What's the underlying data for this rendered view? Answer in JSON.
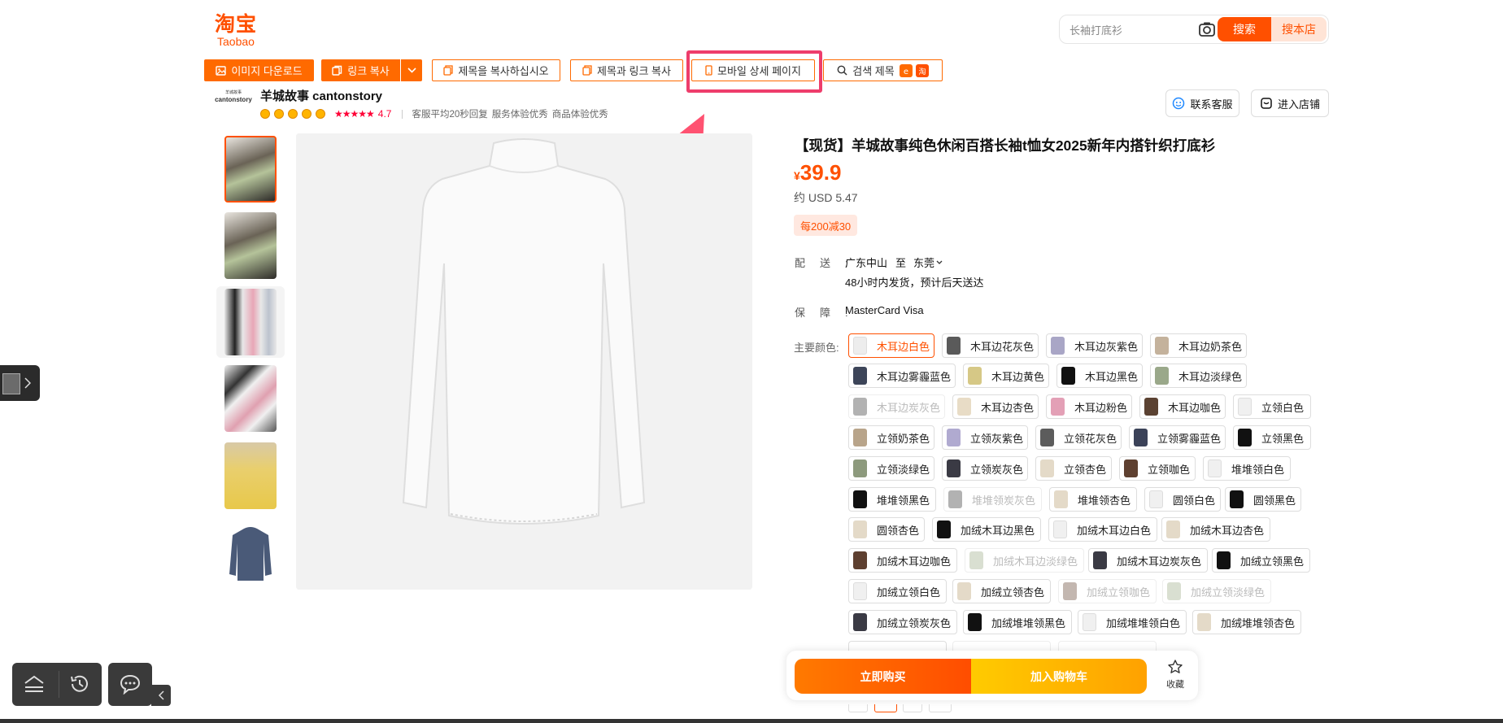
{
  "header": {
    "logo_cn": "淘宝",
    "logo_en": "Taobao",
    "search_placeholder": "长袖打底衫",
    "search_button": "搜索",
    "shop_search_button": "搜本店"
  },
  "toolbar": {
    "download_images": "이미지 다운로드",
    "copy_link": "링크 복사",
    "copy_title": "제목을 복사하십시오",
    "copy_title_link": "제목과 링크 복사",
    "mobile_detail": "모바일 상세 페이지",
    "search_title": "검색 제목"
  },
  "store": {
    "logo_text": "cantonstory",
    "name": "羊城故事 cantonstory",
    "rating": "4.7",
    "tags": [
      "客服平均20秒回复",
      "服务体验优秀",
      "商品体验优秀"
    ],
    "contact_service": "联系客服",
    "enter_store": "进入店铺"
  },
  "product": {
    "title": "【现货】羊城故事纯色休闲百搭长袖t恤女2025新年内搭针织打底衫",
    "currency": "¥",
    "price": "39.9",
    "usd": "约 USD 5.47",
    "promo": "每200减30",
    "shipping_label": "配送:",
    "ship_from": "广东中山",
    "ship_to_word": "至",
    "ship_to": "东莞",
    "ship_note": "48小时内发货，预计后天送达",
    "guarantee_label": "保障:",
    "guarantee": "MasterCard Visa",
    "color_label": "主要颜色:",
    "colors": [
      "木耳边白色",
      "木耳边花灰色",
      "木耳边灰紫色",
      "木耳边奶茶色",
      "木耳边雾霾蓝色",
      "木耳边黄色",
      "木耳边黑色",
      "木耳边淡绿色",
      "木耳边炭灰色",
      "木耳边杏色",
      "木耳边粉色",
      "木耳边咖色",
      "立领白色",
      "立领奶茶色",
      "立领灰紫色",
      "立领花灰色",
      "立领雾霾蓝色",
      "立领黑色",
      "立领淡绿色",
      "立领炭灰色",
      "立领杏色",
      "立领咖色",
      "堆堆领白色",
      "堆堆领黑色",
      "堆堆领炭灰色",
      "堆堆领杏色",
      "圆领白色",
      "圆领黑色",
      "圆领杏色",
      "加绒木耳边黑色",
      "加绒木耳边白色",
      "加绒木耳边杏色",
      "加绒木耳边咖色",
      "加绒木耳边淡绿色",
      "加绒木耳边炭灰色",
      "加绒立领黑色",
      "加绒立领白色",
      "加绒立领杏色",
      "加绒立领咖色",
      "加绒立领淡绿色",
      "加绒立领炭灰色",
      "加绒堆堆领黑色",
      "加绒堆堆领白色",
      "加绒堆堆领杏色"
    ]
  },
  "actions": {
    "buy_now": "立即购买",
    "add_to_cart": "加入购物车",
    "favorite": "收藏"
  }
}
